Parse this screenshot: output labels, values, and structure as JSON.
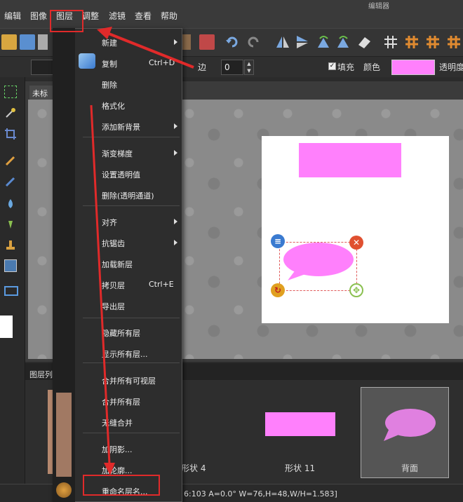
{
  "app": {
    "title": "编辑器"
  },
  "menubar": [
    "编辑",
    "图像",
    "图层",
    "调整",
    "滤镜",
    "查看",
    "帮助"
  ],
  "toolbar2": {
    "edge_label": "边",
    "edge_value": "0",
    "fill_label": "填充",
    "color_label": "颜色",
    "opacity_label": "透明度",
    "fill_checked": true,
    "fill_color": "#ff80fc"
  },
  "document": {
    "tab": "未标"
  },
  "layers_panel": {
    "title": "图层列",
    "thumbs": [
      {
        "label": "形状 4"
      },
      {
        "label": "形状 11"
      },
      {
        "label": "背面"
      }
    ]
  },
  "status": "6:103 A=0.0° W=76,H=48,W/H=1.583]",
  "layer_menu": {
    "items": [
      {
        "label": "新建",
        "submenu": true
      },
      {
        "label": "复制",
        "shortcut": "Ctrl+D"
      },
      {
        "label": "删除"
      },
      {
        "label": "格式化"
      },
      {
        "label": "添加新背景",
        "submenu": true
      },
      {
        "label": "渐变梯度",
        "submenu": true
      },
      {
        "label": "设置透明值"
      },
      {
        "label": "删除(透明通道)"
      },
      {
        "label": "对齐",
        "submenu": true
      },
      {
        "label": "抗锯齿",
        "submenu": true
      },
      {
        "label": "加载新层"
      },
      {
        "label": "拷贝层",
        "shortcut": "Ctrl+E"
      },
      {
        "label": "导出层"
      },
      {
        "label": "隐藏所有层"
      },
      {
        "label": "显示所有层..."
      },
      {
        "label": "合并所有可视层"
      },
      {
        "label": "合并所有层"
      },
      {
        "label": "无缝合并"
      },
      {
        "label": "加阴影..."
      },
      {
        "label": "加轮廓..."
      },
      {
        "label": "重命名层名..."
      }
    ]
  },
  "colors": {
    "accent": "#ff80fc",
    "annotation": "#e02a2a"
  }
}
